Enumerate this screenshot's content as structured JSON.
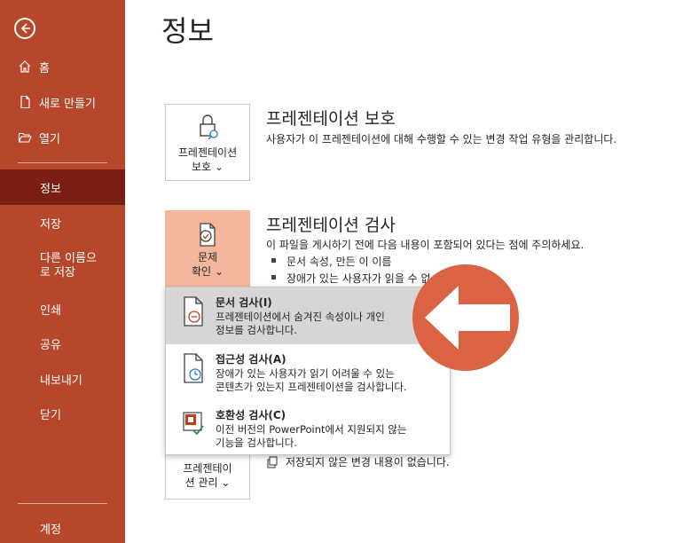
{
  "sidebar": {
    "items": [
      {
        "label": "홈",
        "icon": "home-icon"
      },
      {
        "label": "새로 만들기",
        "icon": "new-file-icon"
      },
      {
        "label": "열기",
        "icon": "folder-open-icon"
      },
      {
        "label": "정보"
      },
      {
        "label": "저장"
      },
      {
        "label": "다른 이름으로 저장"
      },
      {
        "label": "인쇄"
      },
      {
        "label": "공유"
      },
      {
        "label": "내보내기"
      },
      {
        "label": "닫기"
      },
      {
        "label": "계정"
      }
    ],
    "active_index": 3,
    "background": "#b7472a",
    "active_background": "#7a1e14"
  },
  "page": {
    "title": "정보"
  },
  "protect": {
    "tile_label_1": "프레젠테이션",
    "tile_label_2": "보호 ⌄",
    "title": "프레젠테이션 보호",
    "desc": "사용자가 이 프레젠테이션에 대해 수행할 수 있는 변경 작업 유형을 관리합니다."
  },
  "inspect": {
    "tile_label_1": "문제",
    "tile_label_2": "확인 ⌄",
    "title": "프레젠테이션 검사",
    "desc": "이 파일을 게시하기 전에 다음 내용이 포함되어 있다는 점에 주의하세요.",
    "bullets": [
      "문서 속성, 만든 이 이름",
      "장애가 있는 사용자가 읽을 수 없"
    ],
    "tile_color": "#f4b69c"
  },
  "manage": {
    "tile_label_1": "프레젠테이",
    "tile_label_2": "션 관리 ⌄",
    "desc": "저장되지 않은 변경 내용이 없습니다."
  },
  "dropdown": {
    "items": [
      {
        "title": "문서 검사(I)",
        "desc_1": "프레젠테이션에서 숨겨진 속성이나 개인",
        "desc_2": "정보를 검사합니다."
      },
      {
        "title": "접근성 검사(A)",
        "desc_1": "장애가 있는 사용자가 읽기 어려울 수 있는",
        "desc_2": "콘텐츠가 있는지 프레젠테이션을 검사합니다."
      },
      {
        "title": "호환성 검사(C)",
        "desc_1": "이전 버전의 PowerPoint에서 지원되지 않는",
        "desc_2": "기능을 검사합니다."
      }
    ]
  },
  "overlay": {
    "color": "#db6243",
    "icon": "left-arrow-icon"
  }
}
